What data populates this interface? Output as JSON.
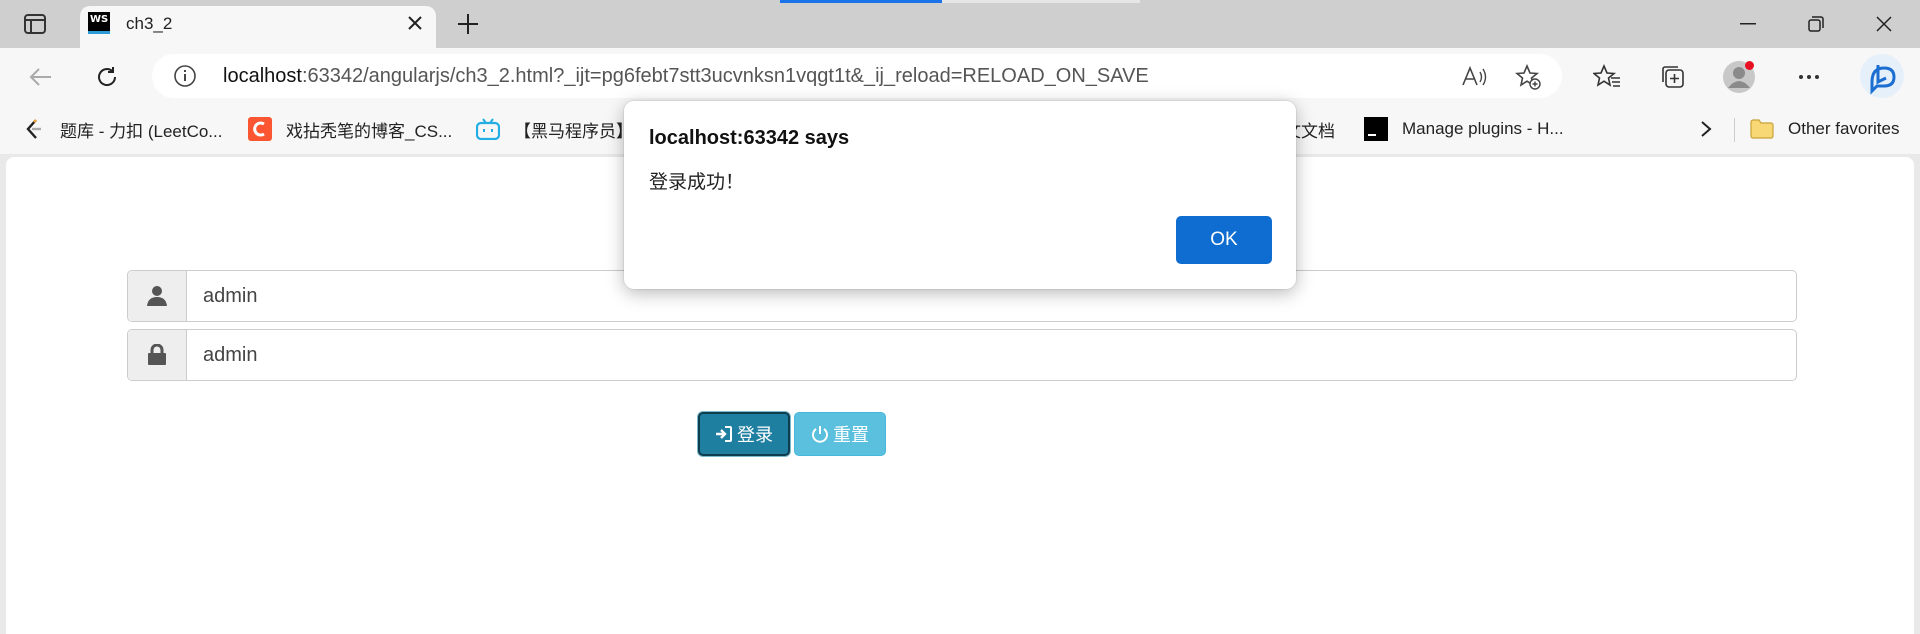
{
  "browser": {
    "tab": {
      "title": "ch3_2",
      "favicon_text": "WS"
    },
    "loading_progress": 0.45,
    "address": {
      "host": "localhost",
      "rest": ":63342/angularjs/ch3_2.html?_ijt=pg6febt7stt3ucvnksn1vqgt1t&_ij_reload=RELOAD_ON_SAVE"
    },
    "bookmarks": [
      {
        "label": "题库 - 力扣 (LeetCo...",
        "icon": "leetcode-icon"
      },
      {
        "label": "戏拈秃笔的博客_CS...",
        "icon": "csdn-icon"
      },
      {
        "label": "【黑马程序员】",
        "icon": "bilibili-icon"
      },
      {
        "label": "文文档",
        "icon": "doc-icon"
      },
      {
        "label": "Manage plugins - H...",
        "icon": "terminal-icon"
      }
    ],
    "other_favorites": "Other favorites"
  },
  "form": {
    "username_value": "admin",
    "password_value": "admin",
    "login_label": "登录",
    "reset_label": "重置"
  },
  "dialog": {
    "title": "localhost:63342 says",
    "message": "登录成功！",
    "ok_label": "OK"
  },
  "colors": {
    "login_button": "#1f7fa1",
    "reset_button": "#5bc0de",
    "dialog_ok": "#0f6cd0"
  }
}
